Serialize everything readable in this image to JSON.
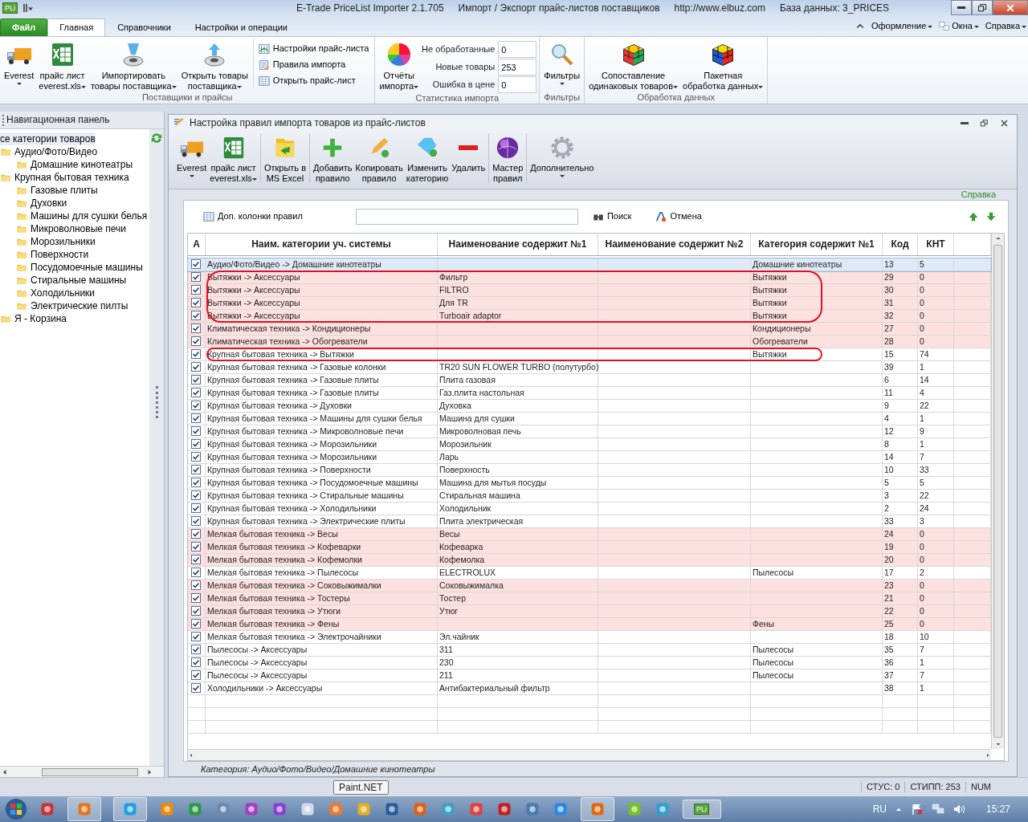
{
  "window": {
    "app_icon": "PLi",
    "title_parts": [
      "E-Trade PriceList Importer 2.1.705",
      "Импорт / Экспорт прайс-листов поставщиков",
      "http://www.elbuz.com",
      "База данных: 3_PRICES"
    ]
  },
  "ribbon_tabs": [
    {
      "label": "Файл",
      "kind": "file",
      "selected": false
    },
    {
      "label": "Главная",
      "kind": "tab",
      "selected": true
    },
    {
      "label": "Справочники",
      "kind": "tab",
      "selected": false
    },
    {
      "label": "Настройки и операции",
      "kind": "tab",
      "selected": false
    }
  ],
  "ribbon_menus": [
    {
      "label": "Оформление"
    },
    {
      "label": "Окна"
    },
    {
      "label": "Справка"
    }
  ],
  "ribbon_groups": [
    {
      "label": "Поставщики и прайсы",
      "items": [
        {
          "kind": "large",
          "label": "Everest",
          "dropdown": true
        },
        {
          "kind": "large",
          "label": "прайс лист\neverest.xls",
          "dropdown": true
        },
        {
          "kind": "large",
          "label": "Импортировать\nтовары поставщика",
          "dropdown": true
        },
        {
          "kind": "large",
          "label": "Открыть товары\nпоставщика",
          "dropdown": true
        },
        {
          "kind": "small_list",
          "entries": [
            "Настройки прайс-листа",
            "Правила импорта",
            "Открыть прайс-лист"
          ]
        }
      ]
    },
    {
      "label": "Статистика импорта",
      "items": [
        {
          "kind": "large",
          "label": "Отчёты\nимпорта",
          "dropdown": true
        },
        {
          "kind": "stats",
          "entries": [
            {
              "label": "Не обработанные",
              "value": "0"
            },
            {
              "label": "Новые товары",
              "value": "253"
            },
            {
              "label": "Ошибка в цене",
              "value": "0"
            }
          ]
        }
      ]
    },
    {
      "label": "Фильтры",
      "items": [
        {
          "kind": "large",
          "label": "Фильтры",
          "dropdown": true
        }
      ]
    },
    {
      "label": "Обработка данных",
      "items": [
        {
          "kind": "large",
          "label": "Сопоставление\nодинаковых товаров",
          "dropdown": true
        },
        {
          "kind": "large",
          "label": "Пакетная\nобработка данных",
          "dropdown": true
        }
      ]
    }
  ],
  "nav_panel": {
    "title": "Навигационная панель",
    "tree": [
      {
        "label": "се категории товаров",
        "selected": true,
        "children": [
          {
            "label": "Аудио/Фото/Видео",
            "selected": false,
            "children": [
              {
                "label": "Домашние кинотеатры",
                "selected": false
              }
            ]
          },
          {
            "label": "Крупная бытовая техника",
            "selected": false,
            "children": [
              {
                "label": "Газовые плиты",
                "selected": false
              },
              {
                "label": "Духовки",
                "selected": false
              },
              {
                "label": "Машины для сушки белья",
                "selected": false
              },
              {
                "label": "Микроволновые печи",
                "selected": false
              },
              {
                "label": "Морозильники",
                "selected": false
              },
              {
                "label": "Поверхности",
                "selected": false
              },
              {
                "label": "Посудомоечные машины",
                "selected": false
              },
              {
                "label": "Стиральные машины",
                "selected": false
              },
              {
                "label": "Холодильники",
                "selected": false
              },
              {
                "label": "Электрические пилты",
                "selected": false
              }
            ]
          },
          {
            "label": "Я - Корзина",
            "selected": false
          }
        ]
      }
    ]
  },
  "doc_window": {
    "title": "Настройка правил импорта товаров из прайс-листов",
    "toolbar_groups": [
      [
        {
          "label": "Everest",
          "dropdown": true
        },
        {
          "label": "прайс лист\neverest.xls",
          "dropdown": true
        }
      ],
      [
        {
          "label": "Открыть в\nMS Excel",
          "dropdown": false
        }
      ],
      [
        {
          "label": "Добавить\nправило",
          "dropdown": false
        },
        {
          "label": "Копировать\nправило",
          "dropdown": false
        },
        {
          "label": "Изменить\nкатегорию",
          "dropdown": false
        },
        {
          "label": "Удалить",
          "dropdown": false
        }
      ],
      [
        {
          "label": "Мастер\nправил",
          "dropdown": false
        }
      ],
      [
        {
          "label": "Дополнительно",
          "dropdown": true
        }
      ]
    ],
    "help_link": "Справка",
    "extra_columns": "Доп. колонки правил",
    "search_button": "Поиск",
    "cancel_button": "Отмена",
    "table": {
      "columns": [
        "A",
        "Наим. категории уч. системы",
        "Наименование содержит №1",
        "Наименование содержит №2",
        "Категория содержит №1",
        "Код",
        "КНТ"
      ],
      "rows": [
        {
          "checked": true,
          "name": "Аудио/Фото/Видео -> Домашние кинотеатры",
          "cat": "Домашние кинотеатры",
          "code": "13",
          "kht": "5",
          "pink": false,
          "selected": true,
          "circled": false
        },
        {
          "checked": true,
          "name": "Вытяжки -> Аксессуары",
          "c1": "Фильтр",
          "cat": "Вытяжки",
          "code": "29",
          "kht": "0",
          "pink": true,
          "selected": false,
          "circled": true
        },
        {
          "checked": true,
          "name": "Вытяжки -> Аксессуары",
          "c1": "FILTRO",
          "cat": "Вытяжки",
          "code": "30",
          "kht": "0",
          "pink": true,
          "selected": false,
          "circled": true
        },
        {
          "checked": true,
          "name": "Вытяжки -> Аксессуары",
          "c1": "Для TR",
          "cat": "Вытяжки",
          "code": "31",
          "kht": "0",
          "pink": true,
          "selected": false,
          "circled": true
        },
        {
          "checked": true,
          "name": "Вытяжки -> Аксессуары",
          "c1": "Turboair adaptor",
          "cat": "Вытяжки",
          "code": "32",
          "kht": "0",
          "pink": true,
          "selected": false,
          "circled": true
        },
        {
          "checked": true,
          "name": "Климатическая техника -> Кондиционеры",
          "cat": "Кондиционеры",
          "code": "27",
          "kht": "0",
          "pink": true,
          "selected": false,
          "circled": false
        },
        {
          "checked": true,
          "name": "Климатическая техника -> Обогреватели",
          "cat": "Обогреватели",
          "code": "28",
          "kht": "0",
          "pink": true,
          "selected": false,
          "circled": false
        },
        {
          "checked": true,
          "name": "Крупная бытовая техника -> Вытяжки",
          "cat": "Вытяжки",
          "code": "15",
          "kht": "74",
          "pink": false,
          "selected": false,
          "circled": true
        },
        {
          "checked": true,
          "name": "Крупная бытовая техника -> Газовые колонки",
          "c1": "TR20 SUN FLOWER TURBO (полутурбо)",
          "code": "39",
          "kht": "1",
          "pink": false,
          "selected": false,
          "circled": false
        },
        {
          "checked": true,
          "name": "Крупная бытовая техника -> Газовые плиты",
          "c1": "Плита газовая",
          "code": "6",
          "kht": "14",
          "pink": false,
          "selected": false,
          "circled": false
        },
        {
          "checked": true,
          "name": "Крупная бытовая техника -> Газовые плиты",
          "c1": "Газ.плита настольная",
          "code": "11",
          "kht": "4",
          "pink": false,
          "selected": false,
          "circled": false
        },
        {
          "checked": true,
          "name": "Крупная бытовая техника -> Духовки",
          "c1": "Духовка",
          "code": "9",
          "kht": "22",
          "pink": false,
          "selected": false,
          "circled": false
        },
        {
          "checked": true,
          "name": "Крупная бытовая техника -> Машины для сушки белья",
          "c1": "Машина для сушки",
          "code": "4",
          "kht": "1",
          "pink": false,
          "selected": false,
          "circled": false
        },
        {
          "checked": true,
          "name": "Крупная бытовая техника -> Микроволновые печи",
          "c1": "Микроволновая печь",
          "code": "12",
          "kht": "9",
          "pink": false,
          "selected": false,
          "circled": false
        },
        {
          "checked": true,
          "name": "Крупная бытовая техника -> Морозильники",
          "c1": "Морозильник",
          "code": "8",
          "kht": "1",
          "pink": false,
          "selected": false,
          "circled": false
        },
        {
          "checked": true,
          "name": "Крупная бытовая техника -> Морозильники",
          "c1": "Ларь",
          "code": "14",
          "kht": "7",
          "pink": false,
          "selected": false,
          "circled": false
        },
        {
          "checked": true,
          "name": "Крупная бытовая техника -> Поверхности",
          "c1": "Поверхность",
          "code": "10",
          "kht": "33",
          "pink": false,
          "selected": false,
          "circled": false
        },
        {
          "checked": true,
          "name": "Крупная бытовая техника -> Посудомоечные машины",
          "c1": "Машина для мытья посуды",
          "code": "5",
          "kht": "5",
          "pink": false,
          "selected": false,
          "circled": false
        },
        {
          "checked": true,
          "name": "Крупная бытовая техника -> Стиральные машины",
          "c1": "Стиральная машина",
          "code": "3",
          "kht": "22",
          "pink": false,
          "selected": false,
          "circled": false
        },
        {
          "checked": true,
          "name": "Крупная бытовая техника -> Холодильники",
          "c1": "Холодильник",
          "code": "2",
          "kht": "24",
          "pink": false,
          "selected": false,
          "circled": false
        },
        {
          "checked": true,
          "name": "Крупная бытовая техника -> Электрические плиты",
          "c1": "Плита электрическая",
          "code": "33",
          "kht": "3",
          "pink": false,
          "selected": false,
          "circled": false
        },
        {
          "checked": true,
          "name": "Мелкая бытовая техника -> Весы",
          "c1": "Весы",
          "code": "24",
          "kht": "0",
          "pink": true,
          "selected": false,
          "circled": false
        },
        {
          "checked": true,
          "name": "Мелкая бытовая техника -> Кофеварки",
          "c1": "Кофеварка",
          "code": "19",
          "kht": "0",
          "pink": true,
          "selected": false,
          "circled": false
        },
        {
          "checked": true,
          "name": "Мелкая бытовая техника -> Кофемолки",
          "c1": "Кофемолка",
          "code": "20",
          "kht": "0",
          "pink": true,
          "selected": false,
          "circled": false
        },
        {
          "checked": true,
          "name": "Мелкая бытовая техника -> Пылесосы",
          "c1": "ELECTROLUX",
          "cat": "Пылесосы",
          "code": "17",
          "kht": "2",
          "pink": false,
          "selected": false,
          "circled": false
        },
        {
          "checked": true,
          "name": "Мелкая бытовая техника -> Соковыжималки",
          "c1": "Соковыжималка",
          "code": "23",
          "kht": "0",
          "pink": true,
          "selected": false,
          "circled": false
        },
        {
          "checked": true,
          "name": "Мелкая бытовая техника -> Тостеры",
          "c1": "Тостер",
          "code": "21",
          "kht": "0",
          "pink": true,
          "selected": false,
          "circled": false
        },
        {
          "checked": true,
          "name": "Мелкая бытовая техника -> Утюги",
          "c1": "Утюг",
          "code": "22",
          "kht": "0",
          "pink": true,
          "selected": false,
          "circled": false
        },
        {
          "checked": true,
          "name": "Мелкая бытовая техника -> Фены",
          "cat": "Фены",
          "code": "25",
          "kht": "0",
          "pink": true,
          "selected": false,
          "circled": false
        },
        {
          "checked": true,
          "name": "Мелкая бытовая техника -> Электрочайники",
          "c1": "Эл.чайник",
          "code": "18",
          "kht": "10",
          "pink": false,
          "selected": false,
          "circled": false
        },
        {
          "checked": true,
          "name": "Пылесосы -> Аксессуары",
          "c1": "311",
          "cat": "Пылесосы",
          "code": "35",
          "kht": "7",
          "pink": false,
          "selected": false,
          "circled": false
        },
        {
          "checked": true,
          "name": "Пылесосы -> Аксессуары",
          "c1": "230",
          "cat": "Пылесосы",
          "code": "36",
          "kht": "1",
          "pink": false,
          "selected": false,
          "circled": false
        },
        {
          "checked": true,
          "name": "Пылесосы -> Аксессуары",
          "c1": "211",
          "cat": "Пылесосы",
          "code": "37",
          "kht": "7",
          "pink": false,
          "selected": false,
          "circled": false
        },
        {
          "checked": true,
          "name": "Холодильники -> Аксессуары",
          "c1": "Антибактериальный фильтр",
          "code": "38",
          "kht": "1",
          "pink": false,
          "selected": false,
          "circled": false
        }
      ]
    },
    "status_text": "Категория: Аудио/Фото/Видео/Домашние кинотеатры"
  },
  "status_bar": [
    "СТУС: 0",
    "СТИПП: 253",
    "NUM"
  ],
  "taskbar": {
    "tooltip": "Paint.NET",
    "active_app_icon": "PLi",
    "language": "RU",
    "time": "15:27"
  }
}
